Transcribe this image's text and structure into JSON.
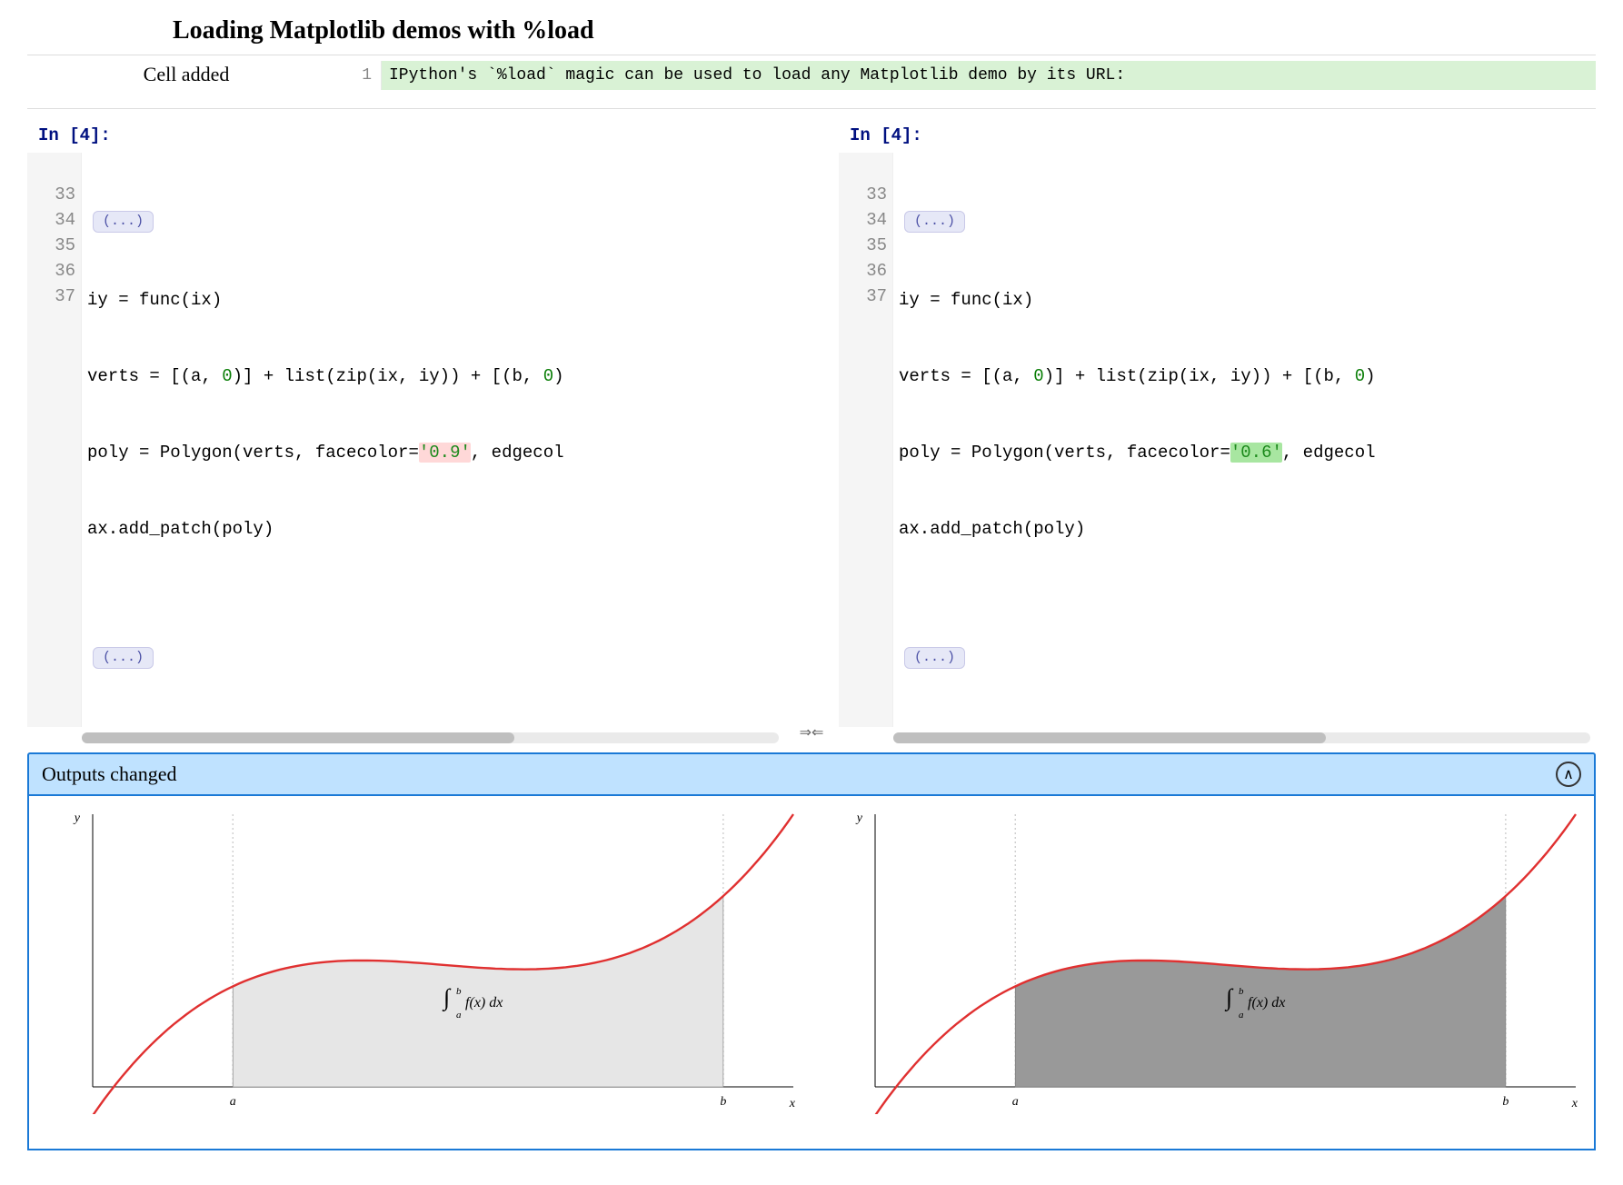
{
  "title": "Loading Matplotlib demos with %load",
  "cell_added": {
    "label": "Cell added",
    "lineno": "1",
    "text": "IPython's `%load` magic can be used to load any Matplotlib demo by its URL:"
  },
  "left": {
    "prompt": "In [4]:",
    "fold": "(...)",
    "fold2": "(...)",
    "gutter": [
      "33",
      "34",
      "35",
      "36",
      "37"
    ],
    "lines": {
      "l33": "iy = func(ix)",
      "l34_a": "verts = [(a, ",
      "l34_zero": "0",
      "l34_b": ")] + list(zip(ix, iy)) + [(b, ",
      "l34_zero2": "0",
      "l34_c": ")",
      "l35_a": "poly = Polygon(verts, facecolor=",
      "l35_str": "'0.9'",
      "l35_b": ", edgecol",
      "l36": "ax.add_patch(poly)",
      "l37": ""
    }
  },
  "right": {
    "prompt": "In [4]:",
    "fold": "(...)",
    "fold2": "(...)",
    "gutter": [
      "33",
      "34",
      "35",
      "36",
      "37"
    ],
    "lines": {
      "l33": "iy = func(ix)",
      "l34_a": "verts = [(a, ",
      "l34_zero": "0",
      "l34_b": ")] + list(zip(ix, iy)) + [(b, ",
      "l34_zero2": "0",
      "l34_c": ")",
      "l35_a": "poly = Polygon(verts, facecolor=",
      "l35_str": "'0.6'",
      "l35_b": ", edgecol",
      "l36": "ax.add_patch(poly)",
      "l37": ""
    }
  },
  "divider_glyph": "⇒⇐",
  "outputs_banner": "Outputs changed",
  "chart_data": [
    {
      "side": "left",
      "facecolor": "0.9",
      "type": "area",
      "title": "",
      "xlabel": "x",
      "ylabel": "y",
      "x_ticks": [
        "a",
        "b"
      ],
      "integral_label": "∫ₐᵇ f(x) dx",
      "curve": {
        "desc": "cubic-like f(x)=(x-3)(x-5)(x-7)+85 on x∈[0,10]",
        "x_range": [
          0,
          10
        ],
        "a": 2,
        "b": 9,
        "sample_points_x": [
          0,
          1,
          2,
          3,
          4,
          5,
          6,
          7,
          8,
          9,
          10
        ],
        "sample_points_y": [
          -20,
          37,
          70,
          85,
          88,
          85,
          82,
          85,
          100,
          133,
          190
        ]
      }
    },
    {
      "side": "right",
      "facecolor": "0.6",
      "type": "area",
      "title": "",
      "xlabel": "x",
      "ylabel": "y",
      "x_ticks": [
        "a",
        "b"
      ],
      "integral_label": "∫ₐᵇ f(x) dx",
      "curve": {
        "desc": "cubic-like f(x)=(x-3)(x-5)(x-7)+85 on x∈[0,10]",
        "x_range": [
          0,
          10
        ],
        "a": 2,
        "b": 9,
        "sample_points_x": [
          0,
          1,
          2,
          3,
          4,
          5,
          6,
          7,
          8,
          9,
          10
        ],
        "sample_points_y": [
          -20,
          37,
          70,
          85,
          88,
          85,
          82,
          85,
          100,
          133,
          190
        ]
      }
    }
  ]
}
